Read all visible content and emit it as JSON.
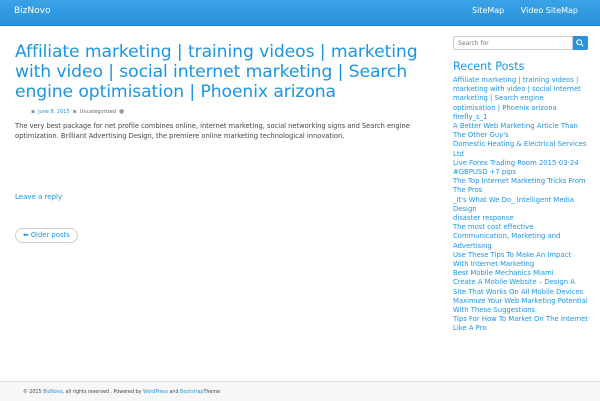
{
  "header": {
    "brand": "BizNovo",
    "nav": [
      "SiteMap",
      "Video SiteMap"
    ]
  },
  "post": {
    "title": "Affiliate marketing | training videos | marketing with video | social internet marketing | Search engine optimisation | Phoenix arizona",
    "date": "June 8, 2015",
    "category": "Uncategorized",
    "excerpt": "The very best package for net profile combines online, internet marketing, social networking signs and Search engine optimization. Brilliant Advertising Design, the premiere online marketing technological innovation.",
    "reply": "Leave a reply"
  },
  "pagination": {
    "older": "Older posts"
  },
  "sidebar": {
    "search_placeholder": "Search for",
    "recent_title": "Recent Posts",
    "recent_posts": [
      "Affiliate marketing | training videos | marketing with video | social internet marketing | Search engine optimisation | Phoenix arizona",
      "firefly_s_1",
      "A Better Web Marketing Article Than The Other Guy's",
      "Domestic Heating & Electrical Services Ltd",
      "Live Forex Trading Room 2015-03-24 #GBPUSD +7 pips",
      "The Top Internet Marketing Tricks From The Pros",
      "_It's What We Do_ Intelligent Media Design",
      "disaster response",
      "The most cost effective Communication, Marketing and Advertising",
      "Use These Tips To Make An Impact With Internet Marketing",
      "Best Mobile Mechanics Miami",
      "Create A Mobile Website – Design A Site That Works On All Mobile Devices",
      "Maximize Your Web Marketing Potential With These Suggestions",
      "Tips For How To Market On The Internet Like A Pro"
    ]
  },
  "footer": {
    "copyright": "© 2015",
    "site": "BizNovo",
    "rights": ", all rights reserved . Powered by",
    "wp": "WordPress",
    "and": "and",
    "bootstrap": "Bootstrap",
    "theme": "Theme"
  }
}
